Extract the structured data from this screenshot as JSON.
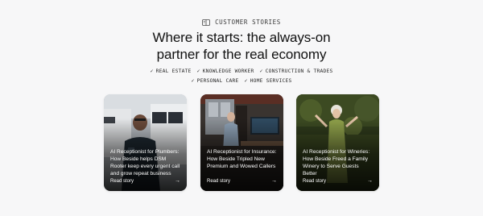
{
  "eyebrow": {
    "icon": "book-icon",
    "label": "CUSTOMER STORIES"
  },
  "headline": {
    "line1": "Where it starts: the always-on",
    "line2": "partner for the real economy"
  },
  "tags": {
    "row1": [
      "REAL ESTATE",
      "KNOWLEDGE WORKER",
      "CONSTRUCTION & TRADES"
    ],
    "row2": [
      "PERSONAL CARE",
      "HOME SERVICES"
    ],
    "check": "✓"
  },
  "cards": [
    {
      "title": "AI Receptionist for Plumbers: How Beside helps DSM Rooter keep every urgent call and grow repeat business",
      "cta": "Read story",
      "arrow": "→"
    },
    {
      "title": "AI Receptionist for Insurance: How Beside Tripled New Premium and Wowed Callers",
      "cta": "Read story",
      "arrow": "→"
    },
    {
      "title": "AI Receptionist for Wineries: How Beside Freed a Family Winery to Serve Guests Better",
      "cta": "Read story",
      "arrow": "→"
    }
  ],
  "colors": {
    "background": "#f7f7f8",
    "text": "#111111",
    "card_text": "#ffffff"
  }
}
